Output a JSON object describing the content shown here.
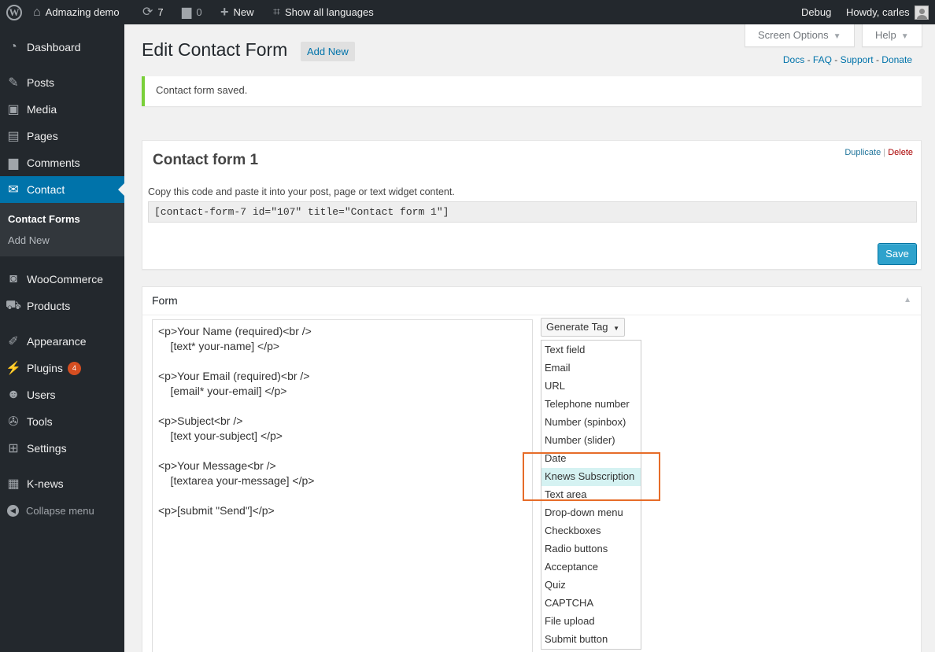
{
  "admin_bar": {
    "site_name": "Admazing demo",
    "updates_count": "7",
    "comments_count": "0",
    "new_label": "New",
    "languages_label": "Show all languages",
    "debug_label": "Debug",
    "howdy": "Howdy, carles"
  },
  "sidebar": {
    "items": [
      {
        "label": "Dashboard",
        "icon": "dashboard-icon"
      },
      {
        "label": "Posts",
        "icon": "pin-icon"
      },
      {
        "label": "Media",
        "icon": "media-icon"
      },
      {
        "label": "Pages",
        "icon": "pages-icon"
      },
      {
        "label": "Comments",
        "icon": "comment-icon"
      },
      {
        "label": "Contact",
        "icon": "mail-icon"
      },
      {
        "label": "WooCommerce",
        "icon": "woo-icon"
      },
      {
        "label": "Products",
        "icon": "cart-icon"
      },
      {
        "label": "Appearance",
        "icon": "brush-icon"
      },
      {
        "label": "Plugins",
        "icon": "plug-icon"
      },
      {
        "label": "Users",
        "icon": "user-icon"
      },
      {
        "label": "Tools",
        "icon": "wrench-icon"
      },
      {
        "label": "Settings",
        "icon": "settings-icon"
      },
      {
        "label": "K-news",
        "icon": "news-icon"
      }
    ],
    "submenu": {
      "current": "Contact Forms",
      "add_new": "Add New"
    },
    "plugins_badge": "4",
    "collapse_label": "Collapse menu"
  },
  "header": {
    "title": "Edit Contact Form",
    "add_new": "Add New",
    "screen_options": "Screen Options",
    "help": "Help",
    "links": [
      "Docs",
      "FAQ",
      "Support",
      "Donate"
    ]
  },
  "notice": {
    "text": "Contact form saved."
  },
  "contact_form": {
    "title": "Contact form 1",
    "duplicate": "Duplicate",
    "delete": "Delete",
    "hint": "Copy this code and paste it into your post, page or text widget content.",
    "shortcode": "[contact-form-7 id=\"107\" title=\"Contact form 1\"]",
    "save": "Save"
  },
  "form_box": {
    "label": "Form",
    "generate_tag": "Generate Tag",
    "tags": [
      "Text field",
      "Email",
      "URL",
      "Telephone number",
      "Number (spinbox)",
      "Number (slider)",
      "Date",
      "Knews Subscription",
      "Text area",
      "Drop-down menu",
      "Checkboxes",
      "Radio buttons",
      "Acceptance",
      "Quiz",
      "CAPTCHA",
      "File upload",
      "Submit button"
    ],
    "highlighted_tag": "Knews Subscription",
    "editor_lines": [
      "<p>Your Name (required)<br />",
      "    [text* your-name] </p>",
      "",
      "<p>Your Email (required)<br />",
      "    [email* your-email] </p>",
      "",
      "<p>Subject<br />",
      "    [text your-subject] </p>",
      "",
      "<p>Your Message<br />",
      "    [textarea your-message] </p>",
      "",
      "<p>[submit \"Send\"]</p>"
    ]
  },
  "colors": {
    "accent": "#0073aa",
    "admin_bg": "#23282d",
    "notice_ok": "#7ad03a",
    "highlight_frame": "#e66c29"
  }
}
